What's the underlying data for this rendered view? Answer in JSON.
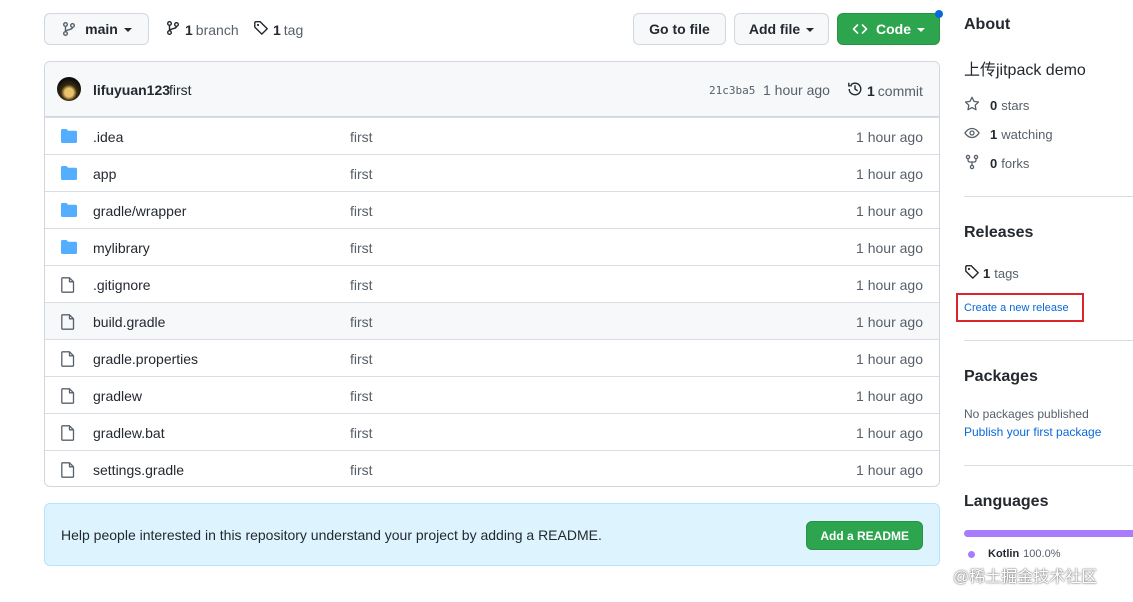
{
  "toolbar": {
    "branch_select": "main",
    "branches": {
      "count": "1",
      "label": "branch"
    },
    "tags": {
      "count": "1",
      "label": "tag"
    },
    "go_to_file": "Go to file",
    "add_file": "Add file",
    "code": "Code",
    "accent": "#2da44e"
  },
  "commit": {
    "author": "lifuyuan123",
    "message": "first",
    "sha": "21c3ba5",
    "age": "1 hour ago",
    "commit_count": "1",
    "commit_label": "commit"
  },
  "files": [
    {
      "name": ".idea",
      "type": "folder",
      "message": "first",
      "age": "1 hour ago"
    },
    {
      "name": "app",
      "type": "folder",
      "message": "first",
      "age": "1 hour ago"
    },
    {
      "name": "gradle/wrapper",
      "type": "folder",
      "message": "first",
      "age": "1 hour ago"
    },
    {
      "name": "mylibrary",
      "type": "folder",
      "message": "first",
      "age": "1 hour ago"
    },
    {
      "name": ".gitignore",
      "type": "file",
      "message": "first",
      "age": "1 hour ago"
    },
    {
      "name": "build.gradle",
      "type": "file",
      "message": "first",
      "age": "1 hour ago"
    },
    {
      "name": "gradle.properties",
      "type": "file",
      "message": "first",
      "age": "1 hour ago"
    },
    {
      "name": "gradlew",
      "type": "file",
      "message": "first",
      "age": "1 hour ago"
    },
    {
      "name": "gradlew.bat",
      "type": "file",
      "message": "first",
      "age": "1 hour ago"
    },
    {
      "name": "settings.gradle",
      "type": "file",
      "message": "first",
      "age": "1 hour ago"
    }
  ],
  "readme": {
    "text": "Help people interested in this repository understand your project by adding a README.",
    "button": "Add a README"
  },
  "about": {
    "heading": "About",
    "description": "上传jitpack demo",
    "stars": {
      "count": "0",
      "label": "stars"
    },
    "watching": {
      "count": "1",
      "label": "watching"
    },
    "forks": {
      "count": "0",
      "label": "forks"
    }
  },
  "releases": {
    "heading": "Releases",
    "tags": {
      "count": "1",
      "label": "tags"
    },
    "create_link": "Create a new release",
    "highlight_color": "#d9262c"
  },
  "packages": {
    "heading": "Packages",
    "empty": "No packages published",
    "link": "Publish your first package"
  },
  "languages": {
    "heading": "Languages",
    "items": [
      {
        "name": "Kotlin",
        "percent": "100.0%",
        "color": "#a97bff"
      }
    ]
  },
  "watermark": "@稀土掘金技术社区"
}
